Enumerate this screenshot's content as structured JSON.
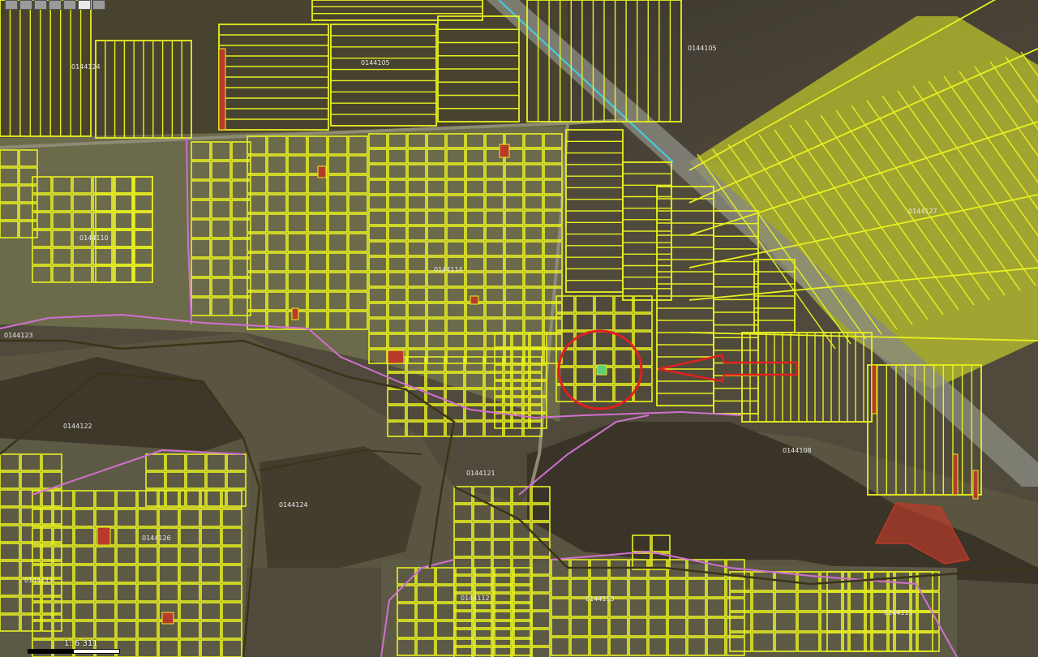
{
  "map": {
    "colors": {
      "parcel_outline": "#e8f020",
      "parcel_fill_selected": "rgba(225,240,40,0.55)",
      "cadastral_boundary": "#d070d0",
      "zone_boundary": "#3a3418",
      "red_parcel": "#b83a2a",
      "highlight_parcel": "#5ad07a",
      "annotation": "#e02020",
      "road": "#8a8a80",
      "road_edge": "#e8f020",
      "canal": "#40d0e8"
    },
    "zones": [
      {
        "label": "0144105"
      },
      {
        "label": "0144105"
      },
      {
        "label": "0144124"
      },
      {
        "label": "0144110"
      },
      {
        "label": "0144123"
      },
      {
        "label": "0144127"
      },
      {
        "label": "0144122"
      },
      {
        "label": "0144124"
      },
      {
        "label": "0144121"
      },
      {
        "label": "0144108"
      },
      {
        "label": "0144126"
      },
      {
        "label": "0144111"
      },
      {
        "label": "0144112"
      },
      {
        "label": "0144113"
      },
      {
        "label": "0144115"
      },
      {
        "label": "0144114"
      }
    ],
    "annotation": {
      "shape": "circle-and-arrow",
      "target": "highlight parcel"
    }
  },
  "toolbar": {
    "buttons": [
      "pan-icon",
      "zoom-in-icon",
      "zoom-out-icon",
      "measure-icon",
      "select-icon",
      "layers-icon",
      "print-icon"
    ]
  },
  "scale": {
    "label": "1: 6 311"
  }
}
